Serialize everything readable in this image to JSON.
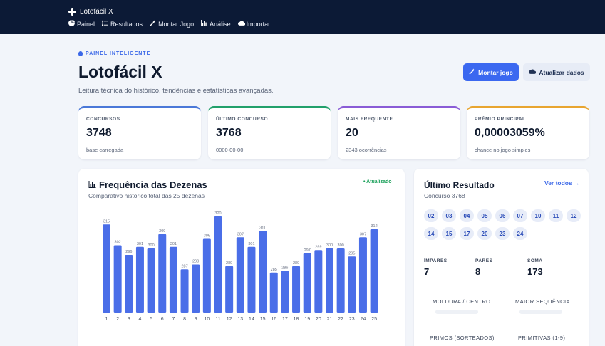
{
  "app": {
    "title": "Lotofácil X"
  },
  "nav": [
    {
      "label": "Painel",
      "icon": "pie-chart-icon"
    },
    {
      "label": "Resultados",
      "icon": "list-icon"
    },
    {
      "label": "Montar Jogo",
      "icon": "magic-wand-icon"
    },
    {
      "label": "Análise",
      "icon": "bar-chart-icon"
    },
    {
      "label": "Importar",
      "icon": "cloud-upload-icon"
    }
  ],
  "header": {
    "eyebrow": "PAINEL INTELIGENTE",
    "title": "Lotofácil X",
    "subtitle": "Leitura técnica do histórico, tendências e estatísticas avançadas.",
    "primary_button": "Montar jogo",
    "secondary_button": "Atualizar dados"
  },
  "stats": [
    {
      "label": "CONCURSOS",
      "value": "3748",
      "sub": "base carregada",
      "color": "#4a78d8"
    },
    {
      "label": "ÚLTIMO CONCURSO",
      "value": "3768",
      "sub": "0000-00-00",
      "color": "#22a06b"
    },
    {
      "label": "MAIS FREQUENTE",
      "value": "20",
      "sub": "2343 ocorrências",
      "color": "#8a5cd6"
    },
    {
      "label": "PRÊMIO PRINCIPAL",
      "value": "0,00003059%",
      "sub": "chance no jogo simples",
      "color": "#e8a530"
    }
  ],
  "frequency": {
    "title": "Frequência das Dezenas",
    "subtitle": "Comparativo histórico total das 25 dezenas",
    "badge": "• Atualizado"
  },
  "chart_data": {
    "type": "bar",
    "categories": [
      "1",
      "2",
      "3",
      "4",
      "5",
      "6",
      "7",
      "8",
      "9",
      "10",
      "11",
      "12",
      "13",
      "14",
      "15",
      "16",
      "17",
      "18",
      "19",
      "20",
      "21",
      "22",
      "23",
      "24",
      "25"
    ],
    "values": [
      315,
      302,
      296,
      301,
      300,
      309,
      301,
      287,
      290,
      306,
      320,
      289,
      307,
      301,
      311,
      285,
      286,
      289,
      297,
      299,
      300,
      300,
      295,
      307,
      312
    ],
    "color": "#4a6ee8"
  },
  "last_result": {
    "title": "Último Resultado",
    "subtitle": "Concurso 3768",
    "see_all": "Ver todos",
    "numbers": [
      "02",
      "03",
      "04",
      "05",
      "06",
      "07",
      "10",
      "11",
      "12",
      "14",
      "15",
      "17",
      "20",
      "23",
      "24"
    ],
    "impares_label": "ÍMPARES",
    "impares_value": "7",
    "pares_label": "PARES",
    "pares_value": "8",
    "soma_label": "SOMA",
    "soma_value": "173",
    "moldura_label": "MOLDURA / CENTRO",
    "sequencia_label": "MAIOR SEQUÊNCIA",
    "primos_label": "PRIMOS (SORTEADOS)",
    "primitivas_label": "PRIMITIVAS (1-9)"
  }
}
